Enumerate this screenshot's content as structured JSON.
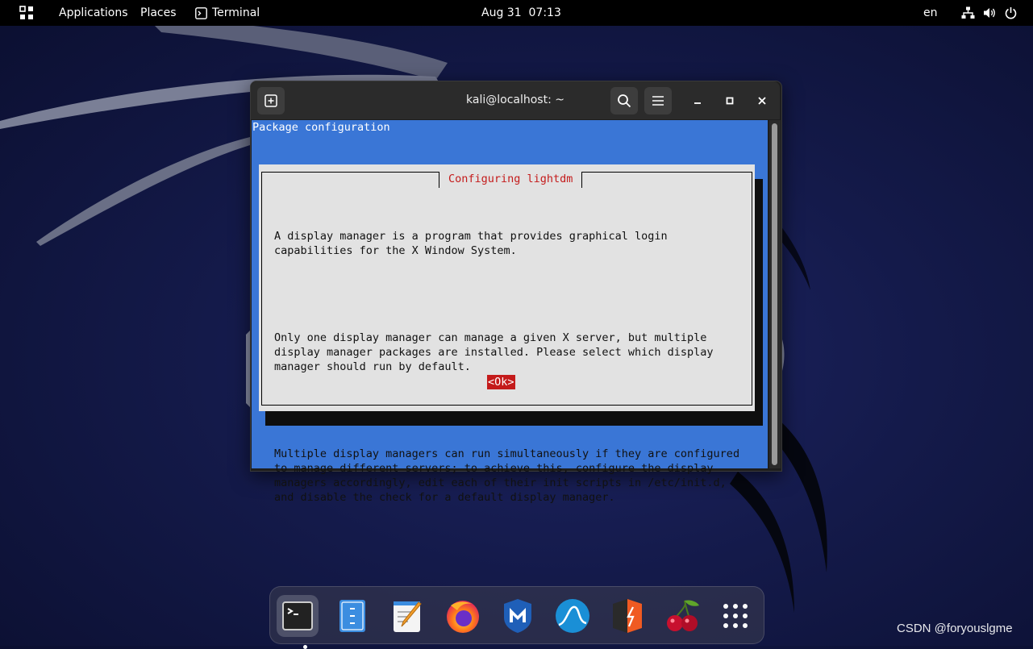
{
  "topbar": {
    "applications": "Applications",
    "places": "Places",
    "terminal": "Terminal",
    "clock": "Aug 31  07:13",
    "language": "en",
    "icons": [
      "apps-grid-icon",
      "network-icon",
      "volume-icon",
      "power-icon"
    ]
  },
  "window": {
    "title": "kali@localhost: ~",
    "new_tab_icon": "new-tab-icon",
    "search_icon": "search-icon",
    "menu_icon": "hamburger-menu-icon"
  },
  "terminal": {
    "package_title": "Package configuration",
    "dialog_title": "Configuring lightdm",
    "paragraphs": [
      "A display manager is a program that provides graphical login\ncapabilities for the X Window System.",
      "Only one display manager can manage a given X server, but multiple\ndisplay manager packages are installed. Please select which display\nmanager should run by default.",
      "Multiple display managers can run simultaneously if they are configured\nto manage different servers; to achieve this, configure the display\nmanagers accordingly, edit each of their init scripts in /etc/init.d,\nand disable the check for a default display manager."
    ],
    "ok_button": "<Ok>",
    "colors": {
      "background": "#3a76d6",
      "dialog": "#e2e2e2",
      "accent": "#c41b1b"
    }
  },
  "dock": {
    "items": [
      "terminal-icon",
      "files-icon",
      "text-editor-icon",
      "firefox-icon",
      "metasploit-icon",
      "wireshark-icon",
      "burpsuite-icon",
      "cherrytree-icon",
      "show-apps-icon"
    ]
  },
  "watermark": "CSDN @foryouslgme"
}
